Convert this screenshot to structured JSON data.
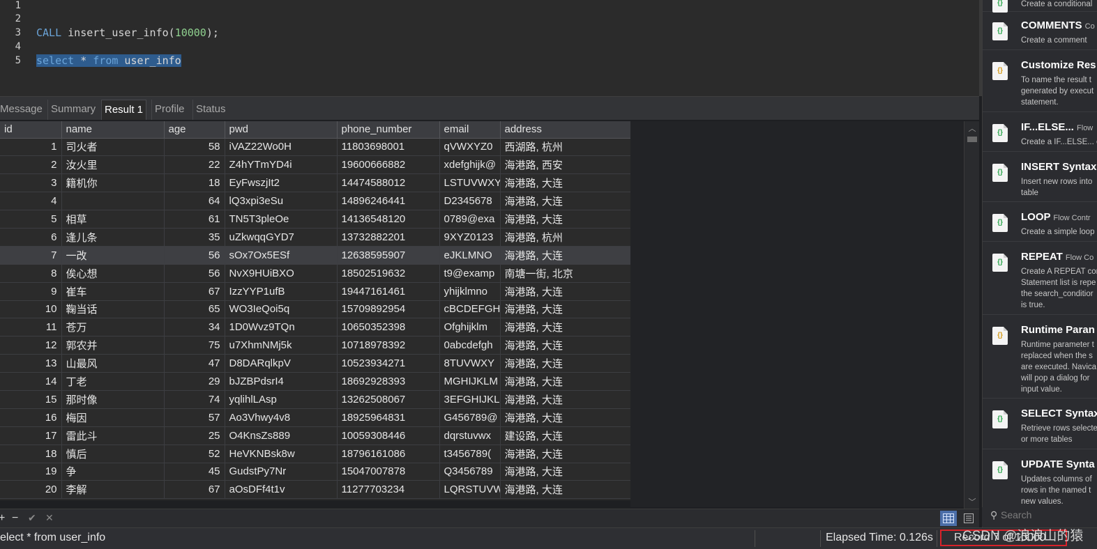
{
  "editor": {
    "line_numbers": [
      "1",
      "2",
      "3",
      "4",
      "5"
    ],
    "line3": {
      "kw": "CALL",
      "fn": "insert_user_info(",
      "arg": "10000",
      "end": ");"
    },
    "line5": {
      "kw1": "select",
      "star": " * ",
      "kw2": "from",
      "tbl": " user_info"
    }
  },
  "tabs": [
    "Message",
    "Summary",
    "Result 1",
    "Profile",
    "Status"
  ],
  "grid": {
    "columns": [
      "id",
      "name",
      "age",
      "pwd",
      "phone_number",
      "email",
      "address"
    ],
    "rows": [
      [
        "1",
        "司火者",
        "58",
        "iVAZ22Wo0H",
        "11803698001",
        "qVWXYZ0",
        "西湖路, 杭州"
      ],
      [
        "2",
        "汝火里",
        "22",
        "Z4hYTmYD4i",
        "19600666882",
        "xdefghijk@",
        "海港路, 西安"
      ],
      [
        "3",
        "籍机你",
        "18",
        "EyFwszjIt2",
        "14474588012",
        "LSTUVWXY",
        "海港路, 大连"
      ],
      [
        "4",
        "",
        "64",
        "lQ3xpi3eSu",
        "14896246441",
        "D2345678",
        "海港路, 大连"
      ],
      [
        "5",
        "相草",
        "61",
        "TN5T3pleOe",
        "14136548120",
        "0789@exa",
        "海港路, 大连"
      ],
      [
        "6",
        "逢儿条",
        "35",
        "uZkwqqGYD7",
        "13732882201",
        "9XYZ0123",
        "海港路, 杭州"
      ],
      [
        "7",
        "一改",
        "56",
        "sOx7Ox5ESf",
        "12638595907",
        "eJKLMNO",
        "海港路, 大连"
      ],
      [
        "8",
        "俟心想",
        "56",
        "NvX9HUiBXO",
        "18502519632",
        "t9@examp",
        "南塘一街, 北京"
      ],
      [
        "9",
        "崔车",
        "67",
        "IzzYYP1ufB",
        "19447161461",
        "yhijklmno",
        "海港路, 大连"
      ],
      [
        "10",
        "鞠当话",
        "65",
        "WO3IeQoi5q",
        "15709892954",
        "cBCDEFGH",
        "海港路, 大连"
      ],
      [
        "11",
        "苍万",
        "34",
        "1D0Wvz9TQn",
        "10650352398",
        "Ofghijklm",
        "海港路, 大连"
      ],
      [
        "12",
        "郭农并",
        "75",
        "u7XhmNMj5k",
        "10718978392",
        "0abcdefgh",
        "海港路, 大连"
      ],
      [
        "13",
        "山最风",
        "47",
        "D8DARqlkpV",
        "10523934271",
        "8TUVWXY",
        "海港路, 大连"
      ],
      [
        "14",
        "丁老",
        "29",
        "bJZBPdsrI4",
        "18692928393",
        "MGHIJKLM",
        "海港路, 大连"
      ],
      [
        "15",
        "那时像",
        "74",
        "yqlihlLAsp",
        "13262508067",
        "3EFGHIJKL",
        "海港路, 大连"
      ],
      [
        "16",
        "梅因",
        "57",
        "Ao3Vhwy4v8",
        "18925964831",
        "G456789@",
        "海港路, 大连"
      ],
      [
        "17",
        "雷此斗",
        "25",
        "O4KnsZs889",
        "10059308446",
        "dqrstuvwx",
        "建设路, 大连"
      ],
      [
        "18",
        "慎后",
        "52",
        "HeVKNBsk8w",
        "18796161086",
        "t3456789(",
        "海港路, 大连"
      ],
      [
        "19",
        "争",
        "45",
        "GudstPy7Nr",
        "15047007878",
        "Q3456789",
        "海港路, 大连"
      ],
      [
        "20",
        "李解",
        "67",
        "aOsDFf4t1v",
        "11277703234",
        "LQRSTUVW",
        "海港路, 大连"
      ]
    ]
  },
  "toolbar": {
    "add": "+",
    "remove": "−",
    "apply": "✔",
    "discard": "✕"
  },
  "status": {
    "sql": "elect * from user_info",
    "elapsed": "Elapsed Time: 0.126s",
    "record": "Record 7 of 10000",
    "watermark": "CSDN @浪浪山的猿"
  },
  "snippets": [
    {
      "title": "",
      "tag": "",
      "desc": [
        "Create a conditional"
      ],
      "icon": "green"
    },
    {
      "title": "COMMENTS",
      "tag": "Co",
      "desc": [
        "Create a comment"
      ],
      "icon": "green"
    },
    {
      "title": "Customize Res",
      "tag": "",
      "desc": [
        "To name the result t",
        "generated by execut",
        "statement."
      ],
      "icon": "yellow"
    },
    {
      "title": "IF...ELSE...",
      "tag": "Flow",
      "desc": [
        "Create a IF...ELSE... c"
      ],
      "icon": "green"
    },
    {
      "title": "INSERT Syntax",
      "tag": "",
      "desc": [
        "Insert new rows into",
        "table"
      ],
      "icon": "green"
    },
    {
      "title": "LOOP",
      "tag": "Flow Contr",
      "desc": [
        "Create a simple loop"
      ],
      "icon": "green"
    },
    {
      "title": "REPEAT",
      "tag": "Flow Co",
      "desc": [
        "Create A REPEAT cor",
        "Statement list is repe",
        "the search_conditior",
        "is true."
      ],
      "icon": "green"
    },
    {
      "title": "Runtime Paran",
      "tag": "",
      "desc": [
        "Runtime parameter t",
        "replaced when the s",
        "are executed. Navica",
        "will pop a dialog for",
        "input value."
      ],
      "icon": "yellow"
    },
    {
      "title": "SELECT Syntax",
      "tag": "",
      "desc": [
        "Retrieve rows selecte",
        "or more tables"
      ],
      "icon": "green"
    },
    {
      "title": "UPDATE Synta",
      "tag": "",
      "desc": [
        "Updates columns of",
        "rows in the named t",
        "new values."
      ],
      "icon": "green"
    }
  ],
  "search": {
    "placeholder": "Search"
  },
  "icons": {
    "grid_view": "grid-icon",
    "form_view": "form-icon",
    "search": "search-icon",
    "snippet": "snippet-file-icon"
  },
  "colors": {
    "keyword": "#6ba4d8",
    "number": "#8fd18f",
    "selection": "#2e5c8e",
    "record_highlight": "#d8222a"
  }
}
